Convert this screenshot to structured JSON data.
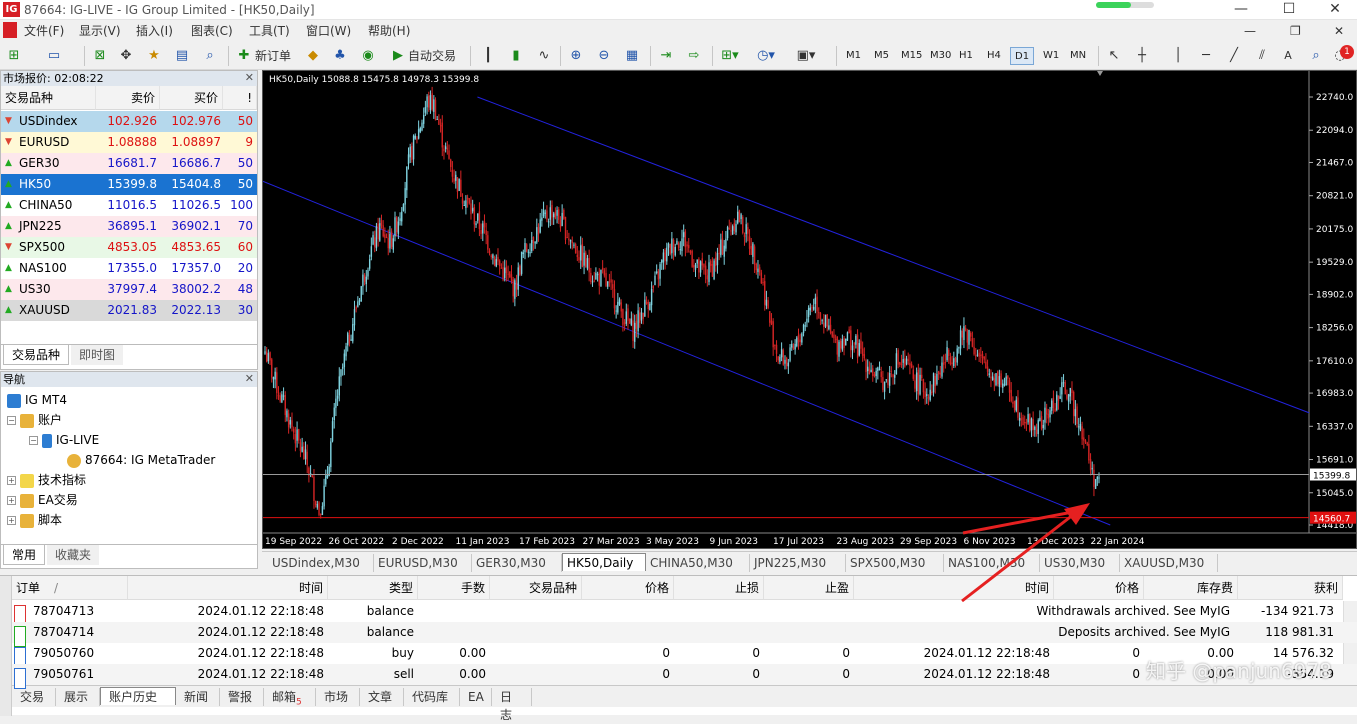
{
  "window": {
    "title": "87664: IG-LIVE - IG Group Limited - [HK50,Daily]",
    "logo": "IG",
    "progress": 0.6,
    "minimize": "—",
    "maximize": "☐",
    "close": "✕"
  },
  "menu": [
    "文件(F)",
    "显示(V)",
    "插入(I)",
    "图表(C)",
    "工具(T)",
    "窗口(W)",
    "帮助(H)"
  ],
  "menu_right": [
    "—",
    "❐",
    "✕"
  ],
  "toolbar": {
    "new_order": "新订单",
    "auto_trade": "自动交易",
    "timeframes": [
      "M1",
      "M5",
      "M15",
      "M30",
      "H1",
      "H4",
      "D1",
      "W1",
      "MN"
    ],
    "active_timeframe": "D1",
    "notification_count": "1"
  },
  "market_watch": {
    "header": "市场报价: 02:08:22",
    "columns": [
      "交易品种",
      "卖价",
      "买价",
      "!"
    ],
    "rows": [
      {
        "symbol": "USDindex",
        "bid": "102.926",
        "ask": "102.976",
        "spread": "50",
        "dir": "down",
        "bg": "#b5d8ec"
      },
      {
        "symbol": "EURUSD",
        "bid": "1.08888",
        "ask": "1.08897",
        "spread": "9",
        "dir": "down",
        "bg": "#fff9d6"
      },
      {
        "symbol": "GER30",
        "bid": "16681.7",
        "ask": "16686.7",
        "spread": "50",
        "dir": "up",
        "bg": "#fde8ec"
      },
      {
        "symbol": "HK50",
        "bid": "15399.8",
        "ask": "15404.8",
        "spread": "50",
        "dir": "up",
        "bg": "#1a73d1"
      },
      {
        "symbol": "CHINA50",
        "bid": "11016.5",
        "ask": "11026.5",
        "spread": "100",
        "dir": "up",
        "bg": "#ffffff"
      },
      {
        "symbol": "JPN225",
        "bid": "36895.1",
        "ask": "36902.1",
        "spread": "70",
        "dir": "up",
        "bg": "#fde8ec"
      },
      {
        "symbol": "SPX500",
        "bid": "4853.05",
        "ask": "4853.65",
        "spread": "60",
        "dir": "down",
        "bg": "#e8f8e6"
      },
      {
        "symbol": "NAS100",
        "bid": "17355.0",
        "ask": "17357.0",
        "spread": "20",
        "dir": "up",
        "bg": "#ffffff"
      },
      {
        "symbol": "US30",
        "bid": "37997.4",
        "ask": "38002.2",
        "spread": "48",
        "dir": "up",
        "bg": "#fde8ec"
      },
      {
        "symbol": "XAUUSD",
        "bid": "2021.83",
        "ask": "2022.13",
        "spread": "30",
        "dir": "up",
        "bg": "#d9d9d9"
      }
    ],
    "tabs": [
      "交易品种",
      "即时图"
    ]
  },
  "navigator": {
    "header": "导航",
    "items": [
      {
        "label": "IG MT4",
        "level": 0
      },
      {
        "label": "账户",
        "level": 1
      },
      {
        "label": "IG-LIVE",
        "level": 2
      },
      {
        "label": "87664: IG MetaTrader",
        "level": 3
      },
      {
        "label": "技术指标",
        "level": 1
      },
      {
        "label": "EA交易",
        "level": 1
      },
      {
        "label": "脚本",
        "level": 1
      }
    ],
    "tabs": [
      "常用",
      "收藏夹"
    ]
  },
  "chart": {
    "ohlc": "HK50,Daily  15088.8 15475.8 14978.3 15399.8",
    "current_price": "15399.8",
    "low_line_label": "14560.7",
    "bg": "#000000",
    "bull_color": "#7fd3e0",
    "bear_color": "#d62525",
    "channel_color": "#2222dd"
  },
  "chart_data": {
    "type": "candlestick",
    "y_ticks": [
      "22740.0",
      "22094.0",
      "21467.0",
      "20821.0",
      "20175.0",
      "19529.0",
      "18902.0",
      "18256.0",
      "17610.0",
      "16983.0",
      "16337.0",
      "15691.0",
      "15045.0",
      "14418.0"
    ],
    "x_ticks": [
      "19 Sep 2022",
      "26 Oct 2022",
      "2 Dec 2022",
      "11 Jan 2023",
      "17 Feb 2023",
      "27 Mar 2023",
      "3 May 2023",
      "9 Jun 2023",
      "17 Jul 2023",
      "23 Aug 2023",
      "29 Sep 2023",
      "6 Nov 2023",
      "13 Dec 2023",
      "22 Jan 2024"
    ],
    "ylim": [
      14418,
      22740
    ],
    "bid_line": 15399.8,
    "low_line": 14560.7,
    "path": [
      [
        0,
        17800
      ],
      [
        6,
        17200
      ],
      [
        15,
        16400
      ],
      [
        25,
        15600
      ],
      [
        32,
        14700
      ],
      [
        36,
        15200
      ],
      [
        42,
        16800
      ],
      [
        48,
        17800
      ],
      [
        55,
        18800
      ],
      [
        62,
        19700
      ],
      [
        68,
        20200
      ],
      [
        74,
        19900
      ],
      [
        80,
        20500
      ],
      [
        86,
        21600
      ],
      [
        92,
        22200
      ],
      [
        96,
        22650
      ],
      [
        100,
        22600
      ],
      [
        106,
        21800
      ],
      [
        112,
        21200
      ],
      [
        118,
        20800
      ],
      [
        124,
        20400
      ],
      [
        130,
        20100
      ],
      [
        136,
        19600
      ],
      [
        142,
        19300
      ],
      [
        148,
        19000
      ],
      [
        152,
        19600
      ],
      [
        158,
        20000
      ],
      [
        164,
        20300
      ],
      [
        170,
        20550
      ],
      [
        176,
        20300
      ],
      [
        182,
        19900
      ],
      [
        188,
        19600
      ],
      [
        194,
        19300
      ],
      [
        200,
        19200
      ],
      [
        206,
        18900
      ],
      [
        212,
        18500
      ],
      [
        218,
        18200
      ],
      [
        224,
        18600
      ],
      [
        230,
        19000
      ],
      [
        236,
        19600
      ],
      [
        242,
        19900
      ],
      [
        248,
        20000
      ],
      [
        252,
        19700
      ],
      [
        256,
        19400
      ],
      [
        262,
        19300
      ],
      [
        268,
        19600
      ],
      [
        274,
        20100
      ],
      [
        280,
        20450
      ],
      [
        286,
        20000
      ],
      [
        292,
        19500
      ],
      [
        296,
        18900
      ],
      [
        300,
        18200
      ],
      [
        304,
        17700
      ],
      [
        310,
        17600
      ],
      [
        316,
        18000
      ],
      [
        322,
        18600
      ],
      [
        326,
        18800
      ],
      [
        332,
        18300
      ],
      [
        338,
        17900
      ],
      [
        344,
        18100
      ],
      [
        350,
        17900
      ],
      [
        356,
        17600
      ],
      [
        362,
        17300
      ],
      [
        368,
        17200
      ],
      [
        374,
        17600
      ],
      [
        380,
        17500
      ],
      [
        386,
        17200
      ],
      [
        392,
        17000
      ],
      [
        398,
        17300
      ],
      [
        404,
        17700
      ],
      [
        410,
        17800
      ],
      [
        414,
        18200
      ],
      [
        418,
        18100
      ],
      [
        422,
        17700
      ],
      [
        428,
        17400
      ],
      [
        434,
        17300
      ],
      [
        440,
        17100
      ],
      [
        446,
        16700
      ],
      [
        452,
        16400
      ],
      [
        458,
        16300
      ],
      [
        464,
        16600
      ],
      [
        470,
        16900
      ],
      [
        474,
        17100
      ],
      [
        478,
        16800
      ],
      [
        482,
        16500
      ],
      [
        486,
        16000
      ],
      [
        490,
        15400
      ],
      [
        494,
        15200
      ]
    ],
    "channel_upper": [
      [
        0.205,
        22740
      ],
      [
        1.0,
        16600
      ]
    ],
    "channel_lower": [
      [
        0.0,
        21100
      ],
      [
        0.81,
        14418
      ]
    ],
    "series": []
  },
  "chart_tabs": [
    "USDindex,M30",
    "EURUSD,M30",
    "GER30,M30",
    "HK50,Daily",
    "CHINA50,M30",
    "JPN225,M30",
    "SPX500,M30",
    "NAS100,M30",
    "US30,M30",
    "XAUUSD,M30"
  ],
  "active_chart_tab": "HK50,Daily",
  "terminal": {
    "columns": [
      "订单",
      "/",
      "时间",
      "类型",
      "手数",
      "交易品种",
      "价格",
      "止损",
      "止盈",
      "时间",
      "价格",
      "库存费",
      "获利"
    ],
    "rows": [
      {
        "order": "78704713",
        "time": "2024.01.12 22:18:48",
        "type": "balance",
        "comment": "Withdrawals archived. See MyIG",
        "profit": "-134 921.73",
        "icon": "down"
      },
      {
        "order": "78704714",
        "time": "2024.01.12 22:18:48",
        "type": "balance",
        "comment": "Deposits archived. See MyIG",
        "profit": "118 981.31",
        "icon": "up"
      },
      {
        "order": "79050760",
        "time": "2024.01.12 22:18:48",
        "type": "buy",
        "lots": "0.00",
        "price": "0",
        "sl": "0",
        "tp": "0",
        "time2": "2024.01.12 22:18:48",
        "price2": "0",
        "swap": "0.00",
        "profit": "14 576.32",
        "icon": "doc"
      },
      {
        "order": "79050761",
        "time": "2024.01.12 22:18:48",
        "type": "sell",
        "lots": "0.00",
        "price": "0",
        "sl": "0",
        "tp": "0",
        "time2": "2024.01.12 22:18:48",
        "price2": "0",
        "swap": "0.00",
        "profit": "-354.19",
        "icon": "doc"
      }
    ],
    "tabs": [
      "交易",
      "展示",
      "账户历史",
      "新闻",
      "警报",
      "邮箱",
      "市场",
      "文章",
      "代码库",
      "EA",
      "日志"
    ],
    "active_tab": "账户历史",
    "mail_badge": "5",
    "side_label": "终端"
  },
  "watermark": "知乎 @panjun6978"
}
